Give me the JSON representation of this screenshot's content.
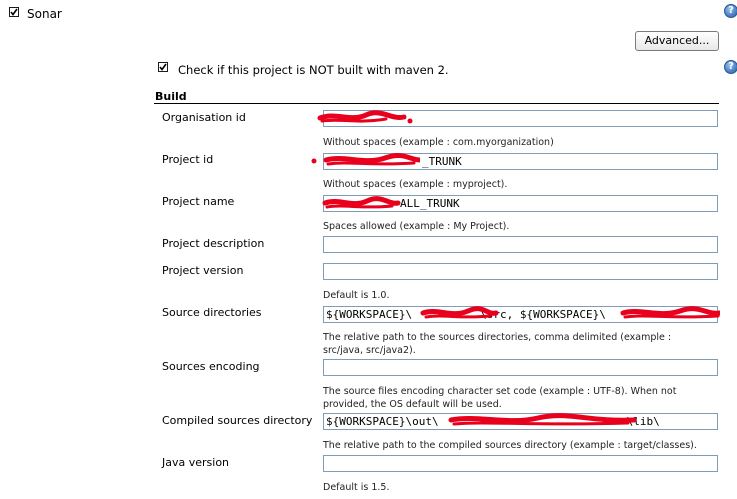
{
  "sonar": {
    "label": "Sonar",
    "checked": true
  },
  "advanced_button": "Advanced...",
  "not_maven": {
    "label": "Check if this project is NOT built with maven 2.",
    "checked": true
  },
  "section_title": "Build",
  "rows": [
    {
      "label": "Organisation id",
      "value": "",
      "hint": "Without spaces (example : com.myorganization)"
    },
    {
      "label": "Project id",
      "value": "_TRUNK",
      "hint": "Without spaces (example : myproject)."
    },
    {
      "label": "Project name",
      "value": "ALL_TRUNK",
      "hint": "Spaces allowed (example : My Project)."
    },
    {
      "label": "Project description",
      "value": "",
      "hint": ""
    },
    {
      "label": "Project version",
      "value": "",
      "hint": "Default is 1.0."
    },
    {
      "label": "Source directories",
      "value": "${WORKSPACE}\\",
      "value_b": "\\src, ${WORKSPACE}\\",
      "hint": "The relative path to the sources directories, comma delimited (example : src/java, src/java2)."
    },
    {
      "label": "Sources encoding",
      "value": "",
      "hint": "The source files encoding character set code (example : UTF-8). When not provided, the OS default will be used."
    },
    {
      "label": "Compiled sources directory",
      "value": "${WORKSPACE}\\out\\",
      "value_b": "\\lib\\",
      "hint": "The relative path to the compiled sources directory (example : target/classes)."
    },
    {
      "label": "Java version",
      "value": "",
      "hint": "Default is 1.5."
    }
  ],
  "redaction_color": "#e8001c"
}
